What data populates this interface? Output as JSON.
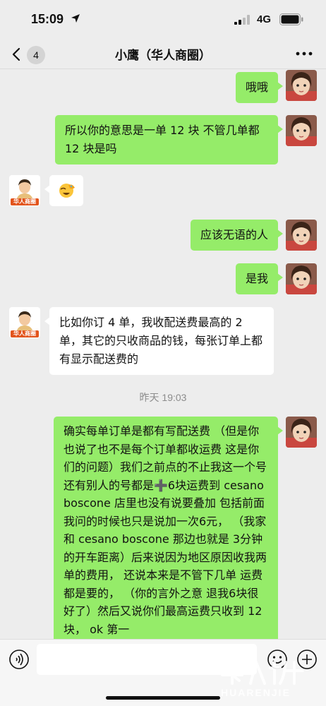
{
  "status_bar": {
    "time": "15:09",
    "location_icon": "location-arrow-icon",
    "network": "4G",
    "signal_icon": "signal-bars-icon",
    "battery_icon": "battery-icon"
  },
  "nav": {
    "back_icon": "chevron-left-icon",
    "unread_count": "4",
    "title": "小鹰（华人商圈）",
    "more_icon": "more-dots-icon"
  },
  "messages": [
    {
      "sender": "me",
      "text": "哦哦"
    },
    {
      "sender": "me",
      "text": "所以你的意思是一单 12 块 不管几单都 12 块是吗"
    },
    {
      "sender": "other",
      "avatar_label": "华人商圈",
      "emoji": "facepalm-laugh-emoji"
    },
    {
      "sender": "me",
      "text": "应该无语的人"
    },
    {
      "sender": "me",
      "text": "是我"
    },
    {
      "sender": "other",
      "avatar_label": "华人商圈",
      "text": "比如你订 4 单，我收配送费最高的 2 单，其它的只收商品的钱，每张订单上都有显示配送费的"
    },
    {
      "type": "timestamp",
      "text": "昨天 19:03"
    },
    {
      "sender": "me",
      "text": "确实每单订单是都有写配送费 （但是你也说了也不是每个订单都收运费 这是你们的问题）我们之前点的不止我这一个号还有别人的号都是➕6块运费到 cesano boscone 店里也没有说要叠加 包括前面我问的时候也只是说加一次6元， （我家和 cesano boscone 那边也就是 3分钟的开车距离）后来说因为地区原因收我两单的费用， 还说本来是不管下几单 运费都是要的， （你的言外之意 退我6块很好了）然后又说你们最高运费只收到 12块， ok 第一"
    }
  ],
  "input_bar": {
    "voice_icon": "voice-icon",
    "emoji_icon": "emoji-icon",
    "plus_icon": "plus-icon"
  },
  "watermark": {
    "text": "HUARENJIE",
    "logo": "huarenjie-logo"
  },
  "colors": {
    "my_bubble": "#95ec69",
    "other_bubble": "#ffffff",
    "background": "#ededed"
  }
}
